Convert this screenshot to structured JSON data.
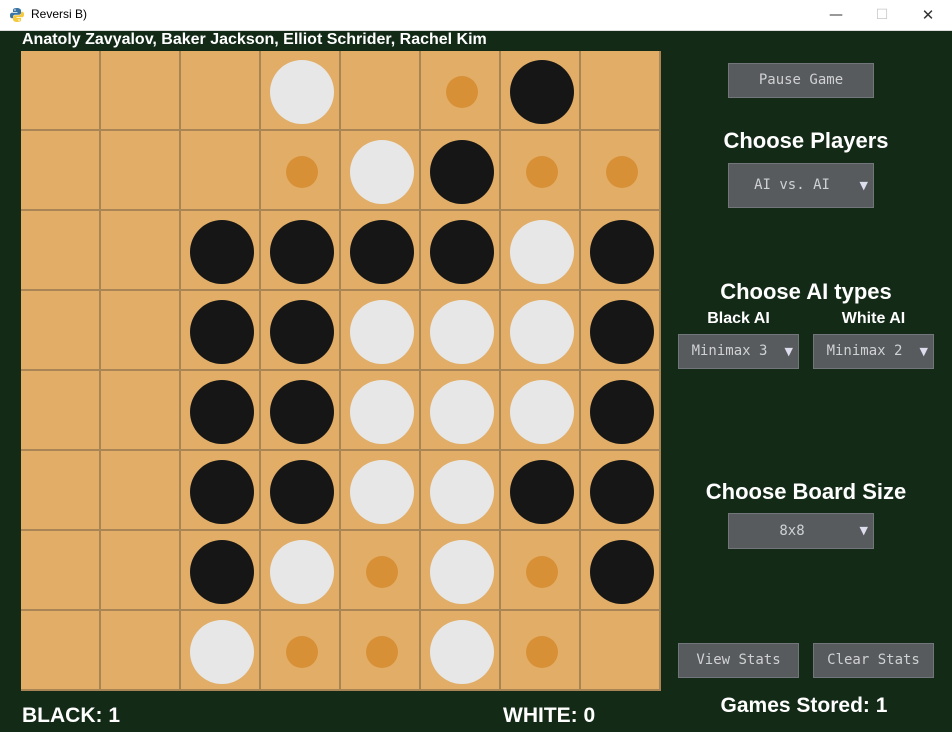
{
  "window": {
    "title": "Reversi B)",
    "min_glyph": "—",
    "max_glyph": "☐",
    "close_glyph": "✕",
    "icon": "python-logo-icon"
  },
  "authors": "Anatoly Zavyalov, Baker Jackson, Elliot Schrider, Rachel Kim",
  "board": {
    "size": 8,
    "rows": [
      "...W.hB..",
      "...hWBhh",
      "..BBBBWB",
      "..BBWWWB",
      "..BBWWWB",
      "..BBWWBB",
      "..BWhWhB",
      "..Whh Wh."
    ],
    "legend": {
      "B": "black",
      "W": "white",
      "h": "legal-move-hint",
      ".": "empty"
    },
    "colors": {
      "cell": "#e2ad66",
      "grid": "#a98454",
      "black": "#161616",
      "white": "#e7e7e7",
      "hint": "#d89037"
    }
  },
  "score": {
    "black": "BLACK: 1",
    "white": "WHITE: 0"
  },
  "controls": {
    "pause_button": "Pause Game",
    "choose_players_heading": "Choose Players",
    "players_dropdown": "AI vs. AI",
    "choose_ai_heading": "Choose AI types",
    "black_ai_label": "Black AI",
    "white_ai_label": "White AI",
    "black_ai_dropdown": "Minimax 3",
    "white_ai_dropdown": "Minimax 2",
    "choose_board_heading": "Choose Board Size",
    "board_size_dropdown": "8x8",
    "view_stats_button": "View Stats",
    "clear_stats_button": "Clear Stats",
    "games_stored": "Games Stored: 1",
    "dropdown_arrow": "▼"
  },
  "colors": {
    "background": "#132a17",
    "button": "#585b5e",
    "button_text": "#cfd1d3"
  }
}
